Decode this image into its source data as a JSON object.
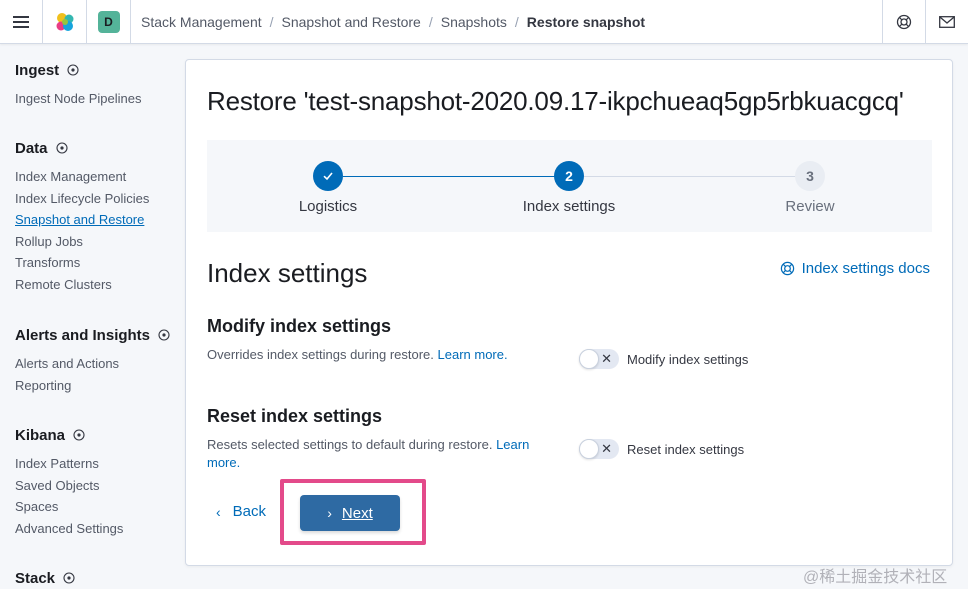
{
  "header": {
    "avatar_letter": "D",
    "breadcrumbs": [
      "Stack Management",
      "Snapshot and Restore",
      "Snapshots",
      "Restore snapshot"
    ]
  },
  "sidebar": {
    "groups": [
      {
        "title": "Ingest",
        "items": [
          "Ingest Node Pipelines"
        ]
      },
      {
        "title": "Data",
        "items": [
          "Index Management",
          "Index Lifecycle Policies",
          "Snapshot and Restore",
          "Rollup Jobs",
          "Transforms",
          "Remote Clusters"
        ],
        "active": "Snapshot and Restore"
      },
      {
        "title": "Alerts and Insights",
        "items": [
          "Alerts and Actions",
          "Reporting"
        ]
      },
      {
        "title": "Kibana",
        "items": [
          "Index Patterns",
          "Saved Objects",
          "Spaces",
          "Advanced Settings"
        ]
      },
      {
        "title": "Stack",
        "items": []
      }
    ]
  },
  "main": {
    "title": "Restore 'test-snapshot-2020.09.17-ikpchueaq5gp5rbkuacgcq'",
    "steps": [
      {
        "number": "1",
        "label": "Logistics",
        "status": "complete"
      },
      {
        "number": "2",
        "label": "Index settings",
        "status": "current"
      },
      {
        "number": "3",
        "label": "Review",
        "status": "pending"
      }
    ],
    "section_title": "Index settings",
    "docs_link": "Index settings docs",
    "modify": {
      "title": "Modify index settings",
      "description": "Overrides index settings during restore.",
      "learn_more": "Learn more.",
      "switch_label": "Modify index settings",
      "switch_on": false
    },
    "reset": {
      "title": "Reset index settings",
      "description": "Resets selected settings to default during restore.",
      "learn_more": "Learn more.",
      "switch_label": "Reset index settings",
      "switch_on": false
    },
    "back_label": "Back",
    "next_label": "Next"
  },
  "colors": {
    "accent": "#006bb8",
    "primary_button": "#2e6aa3",
    "highlight": "#e34a8a"
  },
  "watermark": "@稀土掘金技术社区"
}
